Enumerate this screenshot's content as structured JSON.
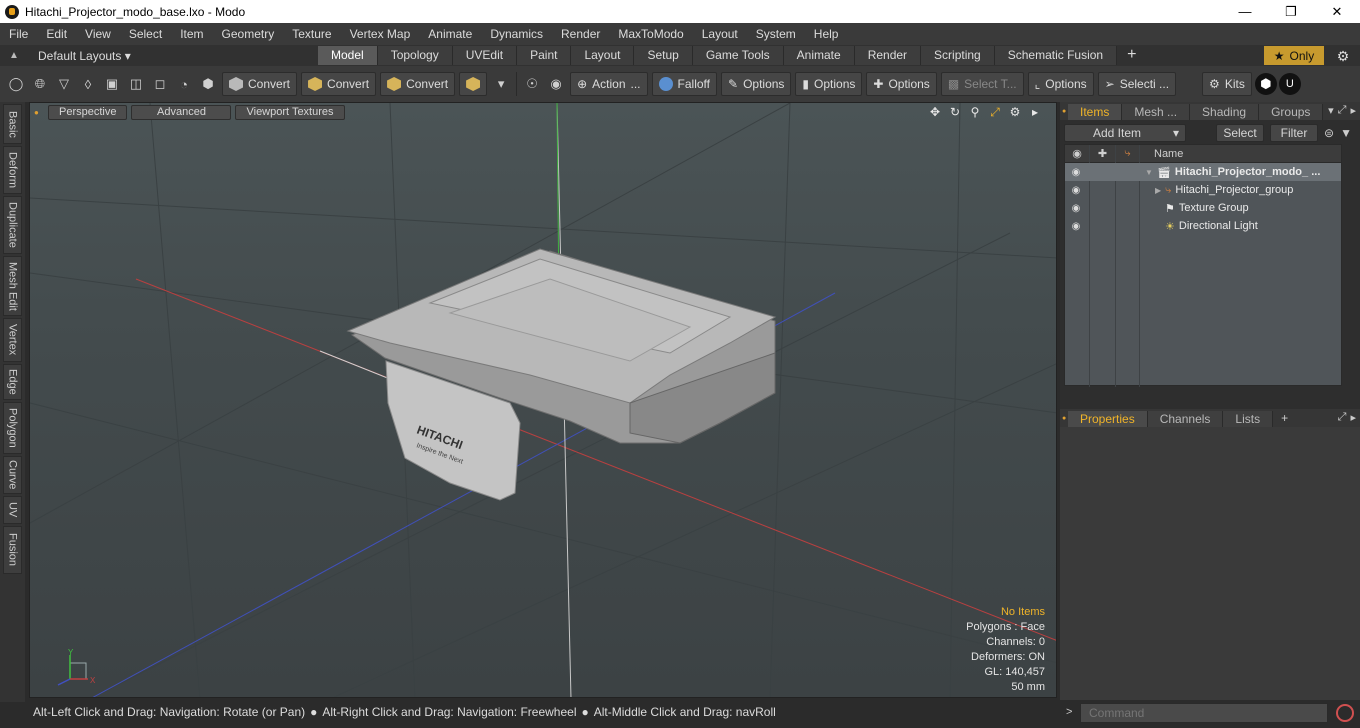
{
  "window": {
    "title": "Hitachi_Projector_modo_base.lxo - Modo"
  },
  "menu": [
    "File",
    "Edit",
    "View",
    "Select",
    "Item",
    "Geometry",
    "Texture",
    "Vertex Map",
    "Animate",
    "Dynamics",
    "Render",
    "MaxToModo",
    "Layout",
    "System",
    "Help"
  ],
  "layouts": {
    "default_label": "Default Layouts ▾",
    "tabs": [
      "Model",
      "Topology",
      "UVEdit",
      "Paint",
      "Layout",
      "Setup",
      "Game Tools",
      "Animate",
      "Render",
      "Scripting",
      "Schematic Fusion"
    ],
    "active_tab": "Model",
    "only_label": "Only"
  },
  "toolbar": {
    "convert1": "Convert",
    "convert2": "Convert",
    "convert3": "Convert",
    "action": "Action",
    "falloff": "Falloff",
    "options1": "Options",
    "options2": "Options",
    "options3": "Options",
    "select_t": "Select T...",
    "options4": "Options",
    "selecti": "Selecti ...",
    "kits": "Kits"
  },
  "left_tabs": [
    "Basic",
    "Deform",
    "Duplicate",
    "Mesh Edit",
    "Vertex",
    "Edge",
    "Polygon",
    "Curve",
    "UV",
    "Fusion"
  ],
  "viewport": {
    "tabs": [
      "Perspective",
      "Advanced",
      "Viewport Textures"
    ],
    "info": {
      "no_items": "No Items",
      "polygons": "Polygons : Face",
      "channels": "Channels: 0",
      "deformers": "Deformers: ON",
      "gl": "GL: 140,457",
      "unit": "50 mm"
    },
    "model_text": [
      "HITACHI",
      "Inspire the Next"
    ],
    "axis_y": "Y",
    "axis_x": "X"
  },
  "items_panel": {
    "tabs": [
      "Items",
      "Mesh ...",
      "Shading",
      "Groups"
    ],
    "active_tab": "Items",
    "add_item": "Add Item",
    "select": "Select",
    "filter": "Filter",
    "name_header": "Name",
    "rows": [
      {
        "label": "Hitachi_Projector_modo_ ...",
        "bold": true
      },
      {
        "label": "Hitachi_Projector_group",
        "bold": false
      },
      {
        "label": "Texture Group",
        "bold": false
      },
      {
        "label": "Directional Light",
        "bold": false
      }
    ]
  },
  "properties_panel": {
    "tabs": [
      "Properties",
      "Channels",
      "Lists"
    ],
    "active_tab": "Properties"
  },
  "status": {
    "hint1": "Alt-Left Click and Drag: Navigation: Rotate (or Pan)",
    "hint2": "Alt-Right Click and Drag: Navigation: Freewheel",
    "hint3": "Alt-Middle Click and Drag: navRoll"
  },
  "command": {
    "placeholder": "Command"
  },
  "colors": {
    "accent": "#f0b429",
    "active_tab": "#5a5a5a",
    "viewport_bg": "#454d4f"
  }
}
